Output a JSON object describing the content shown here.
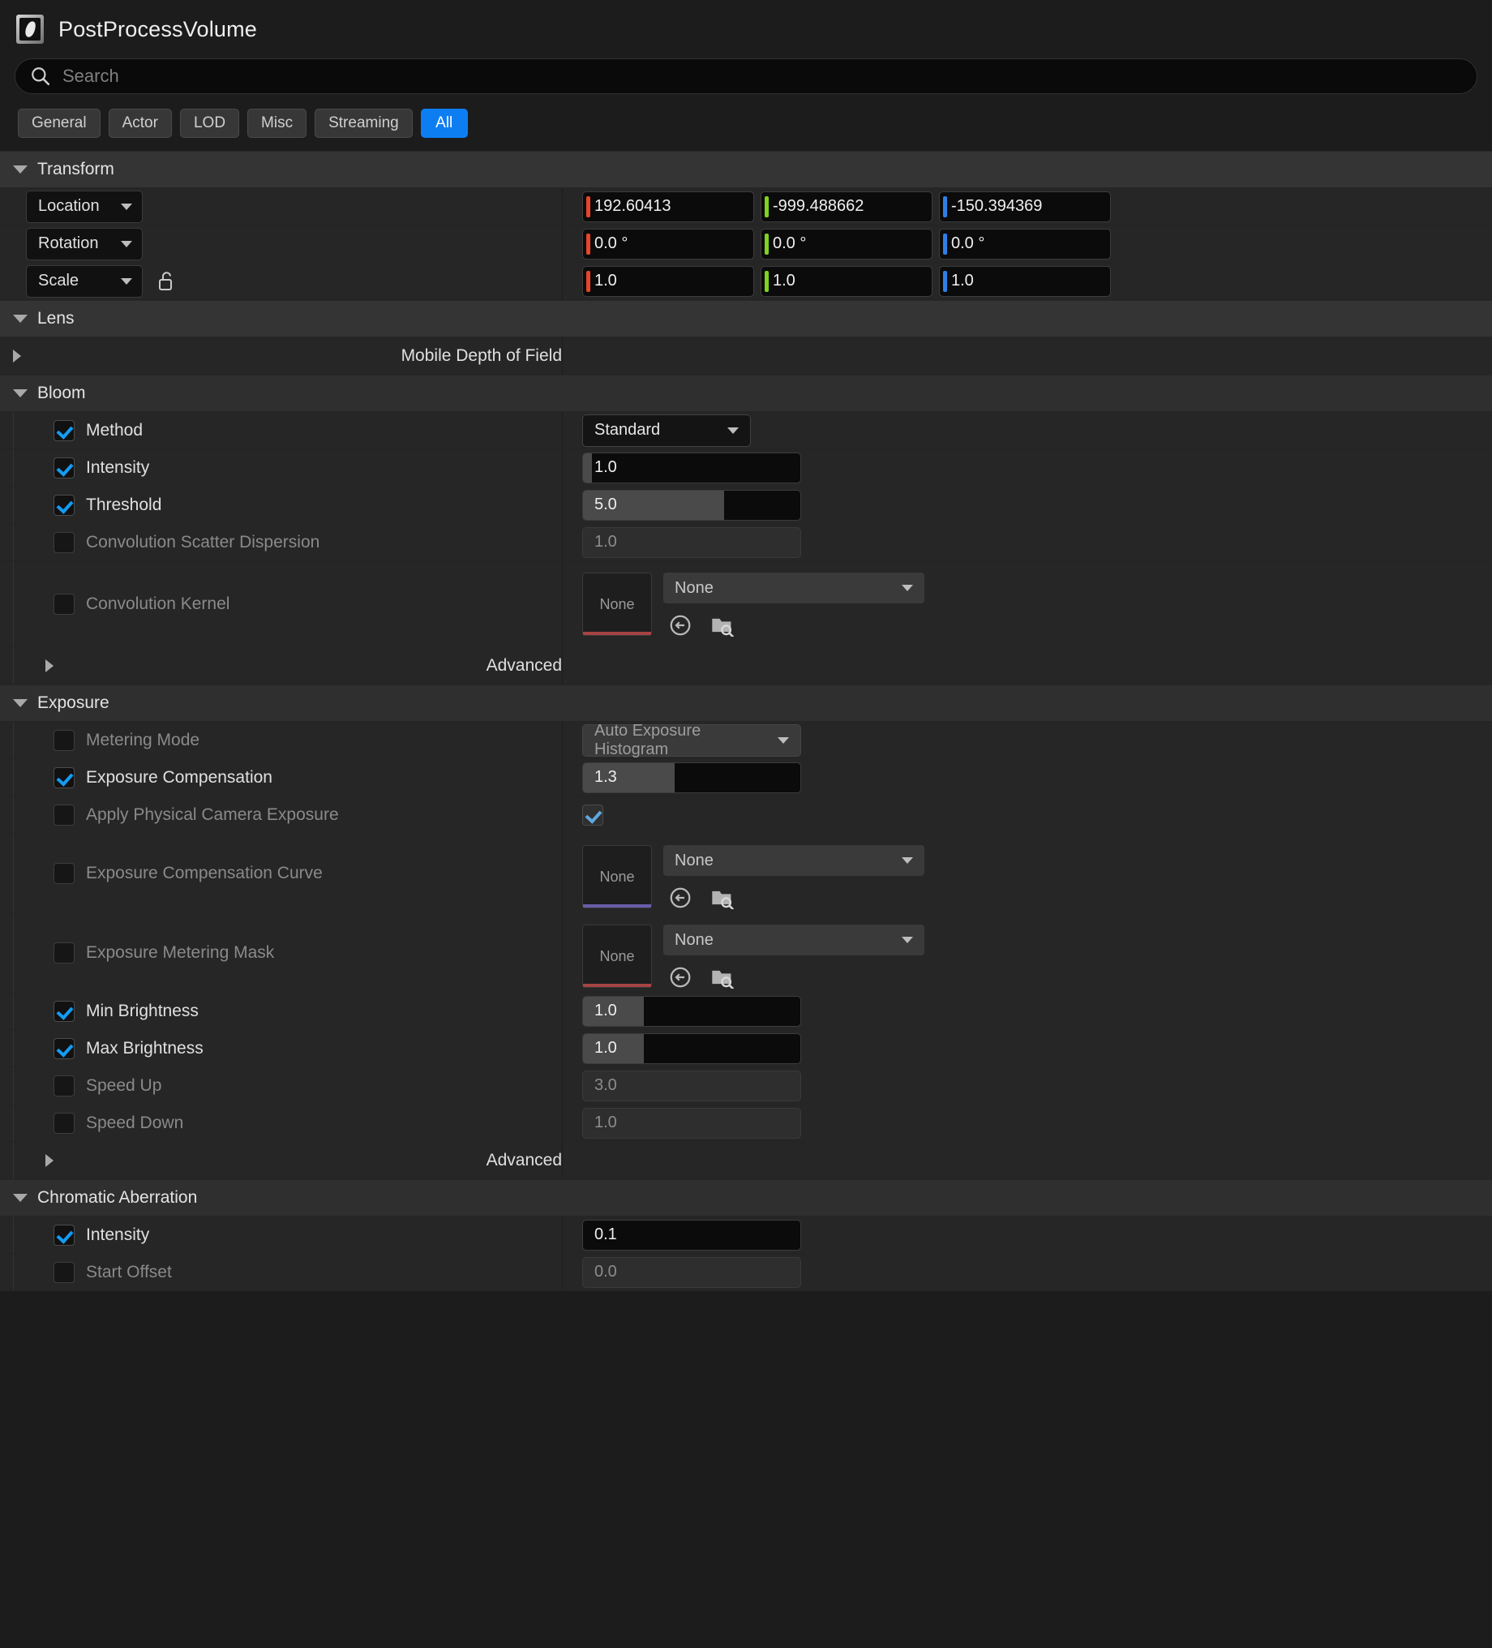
{
  "header": {
    "title": "PostProcessVolume",
    "icon": "postprocessvolume-icon"
  },
  "search": {
    "placeholder": "Search",
    "value": "",
    "icon": "search-icon"
  },
  "tabs": [
    {
      "label": "General",
      "active": false
    },
    {
      "label": "Actor",
      "active": false
    },
    {
      "label": "LOD",
      "active": false
    },
    {
      "label": "Misc",
      "active": false
    },
    {
      "label": "Streaming",
      "active": false
    },
    {
      "label": "All",
      "active": true
    }
  ],
  "transform": {
    "title": "Transform",
    "rows": [
      {
        "name": "Location",
        "x": "192.60413",
        "y": "-999.488662",
        "z": "-150.394369"
      },
      {
        "name": "Rotation",
        "x": "0.0 °",
        "y": "0.0 °",
        "z": "0.0 °"
      },
      {
        "name": "Scale",
        "x": "1.0",
        "y": "1.0",
        "z": "1.0"
      }
    ]
  },
  "lens": {
    "title": "Lens"
  },
  "mobile_dof": {
    "title": "Mobile Depth of Field"
  },
  "bloom": {
    "title": "Bloom",
    "method": {
      "label": "Method",
      "value": "Standard",
      "checked": true
    },
    "intensity": {
      "label": "Intensity",
      "value": "1.0",
      "checked": true,
      "fill": 4
    },
    "threshold": {
      "label": "Threshold",
      "value": "5.0",
      "checked": true,
      "fill": 65
    },
    "scatter": {
      "label": "Convolution Scatter Dispersion",
      "value": "1.0",
      "checked": false
    },
    "kernel": {
      "label": "Convolution Kernel",
      "thumb": "None",
      "value": "None",
      "checked": false,
      "accent": "#a64343"
    },
    "advanced": {
      "label": "Advanced"
    }
  },
  "exposure": {
    "title": "Exposure",
    "metering": {
      "label": "Metering Mode",
      "value": "Auto Exposure Histogram",
      "checked": false
    },
    "compensation": {
      "label": "Exposure Compensation",
      "value": "1.3",
      "checked": true,
      "fill": 42
    },
    "physical": {
      "label": "Apply Physical Camera Exposure",
      "checked": false,
      "value_checked": true
    },
    "comp_curve": {
      "label": "Exposure Compensation Curve",
      "thumb": "None",
      "value": "None",
      "checked": false,
      "accent": "#6a5ca8"
    },
    "metering_mask": {
      "label": "Exposure Metering Mask",
      "thumb": "None",
      "value": "None",
      "checked": false,
      "accent": "#a64343"
    },
    "min_brightness": {
      "label": "Min Brightness",
      "value": "1.0",
      "checked": true,
      "fill": 28
    },
    "max_brightness": {
      "label": "Max Brightness",
      "value": "1.0",
      "checked": true,
      "fill": 28
    },
    "speed_up": {
      "label": "Speed Up",
      "value": "3.0",
      "checked": false
    },
    "speed_down": {
      "label": "Speed Down",
      "value": "1.0",
      "checked": false
    },
    "advanced": {
      "label": "Advanced"
    }
  },
  "chromatic": {
    "title": "Chromatic Aberration",
    "intensity": {
      "label": "Intensity",
      "value": "0.1",
      "checked": true
    },
    "start_offset": {
      "label": "Start Offset",
      "value": "0.0",
      "checked": false
    }
  },
  "colors": {
    "accent": "#0c7ef2",
    "axis_x": "#e8452a",
    "axis_y": "#7ed321",
    "axis_z": "#2f7fe8"
  }
}
